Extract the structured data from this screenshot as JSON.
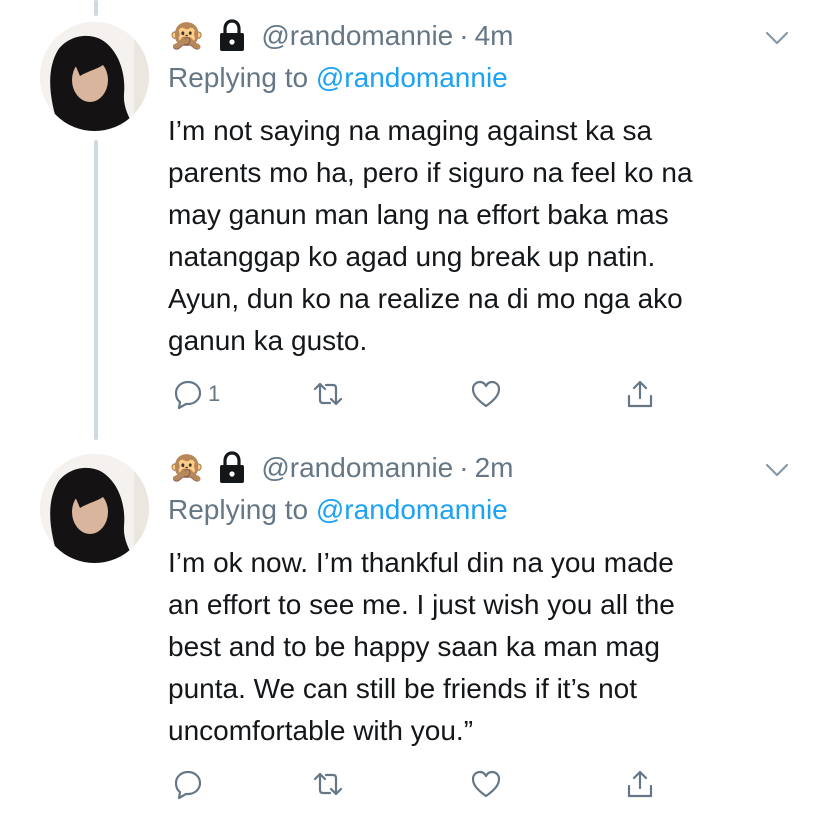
{
  "tweets": [
    {
      "emoji": "🙊",
      "handle": "@randomannie",
      "separator": "·",
      "time": "4m",
      "replying_prefix": "Replying to",
      "replying_to": "@randomannie",
      "lines": [
        "I’m not saying na maging against ka sa",
        "parents mo ha, pero if siguro na feel ko na",
        "may ganun man lang na effort baka mas",
        "natanggap ko agad ung break up natin.",
        "Ayun, dun ko na realize na di mo nga ako",
        "ganun ka gusto."
      ],
      "reply_count": "1"
    },
    {
      "emoji": "🙊",
      "handle": "@randomannie",
      "separator": "·",
      "time": "2m",
      "replying_prefix": "Replying to",
      "replying_to": "@randomannie",
      "lines": [
        "I’m ok now. I’m thankful din na you made",
        "an effort to see me. I just wish you all the",
        "best and to be happy saan ka man mag",
        "punta. We can still be friends if it’s not",
        "uncomfortable with you.”"
      ],
      "reply_count": ""
    }
  ],
  "colors": {
    "text": "#14171a",
    "secondary": "#657786",
    "mention": "#1da1f2",
    "thread_line": "#cfd9de"
  },
  "icons": [
    "see-no-evil-emoji",
    "lock-icon",
    "chevron-down-icon",
    "reply-icon",
    "retweet-icon",
    "like-icon",
    "share-icon"
  ]
}
